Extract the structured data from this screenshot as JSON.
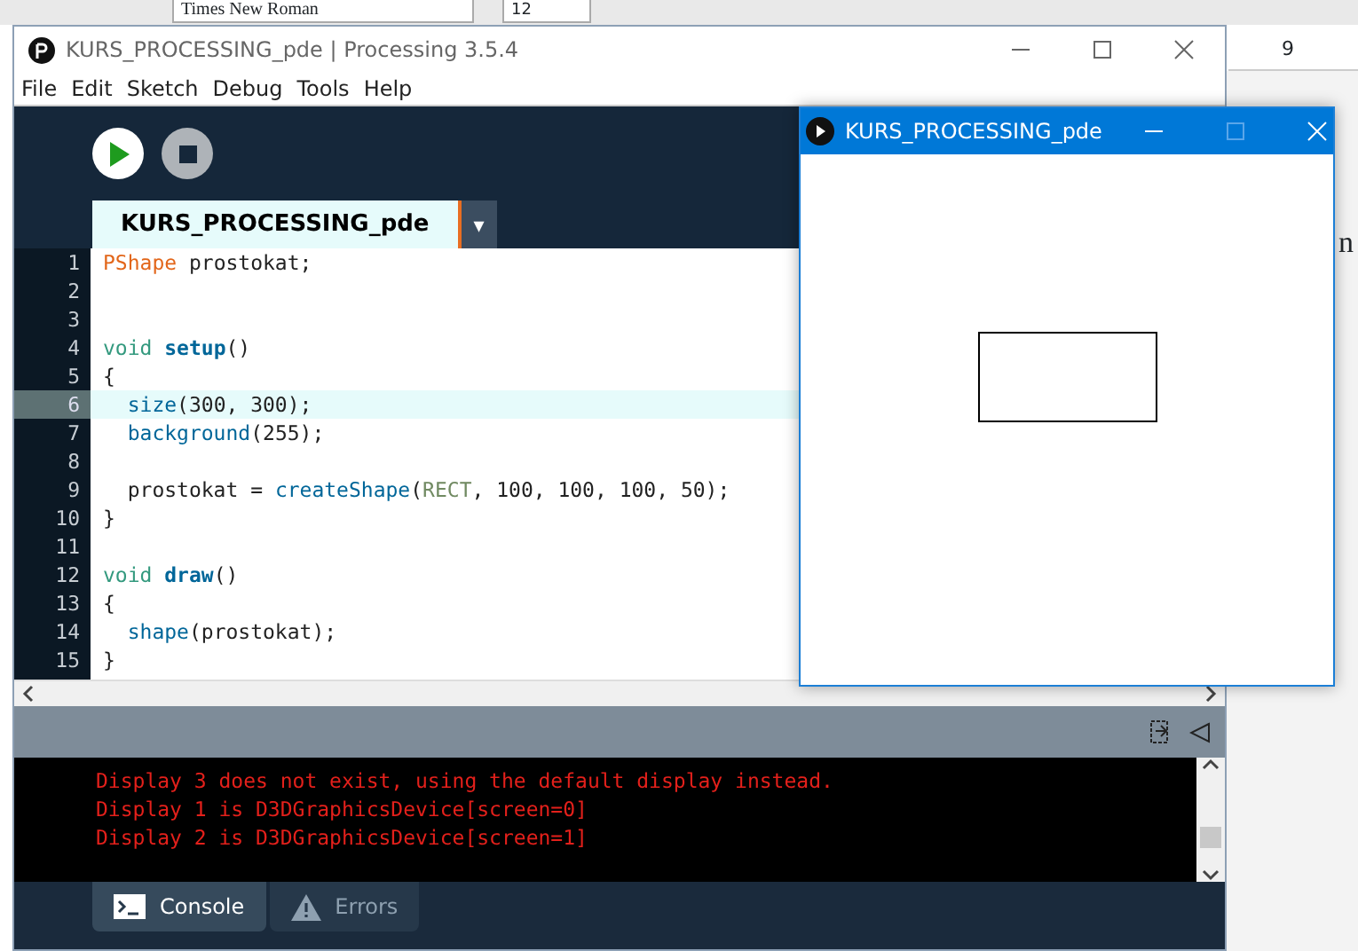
{
  "background_app": {
    "font_field": "Times New Roman",
    "size_field": "12",
    "ruler_number": "9",
    "page_text": "n"
  },
  "window": {
    "title": "KURS_PROCESSING_pde | Processing 3.5.4"
  },
  "menu": [
    "File",
    "Edit",
    "Sketch",
    "Debug",
    "Tools",
    "Help"
  ],
  "tabs": [
    {
      "label": "KURS_PROCESSING_pde",
      "selected": true
    }
  ],
  "tab_menu": "▾",
  "editor": {
    "lines": [
      {
        "number": "1",
        "highlighted": false,
        "tokens": [
          {
            "text": "PShape",
            "kind": "type"
          },
          {
            "text": " prostokat;",
            "kind": "plain"
          }
        ]
      },
      {
        "number": "2",
        "highlighted": false
      },
      {
        "number": "3",
        "highlighted": false
      },
      {
        "number": "4",
        "highlighted": false,
        "tokens": [
          {
            "text": "void ",
            "kind": "keyword"
          },
          {
            "text": "setup",
            "kind": "definition"
          },
          {
            "text": "()",
            "kind": "plain"
          }
        ]
      },
      {
        "number": "5",
        "highlighted": false,
        "tokens": [
          {
            "text": "{",
            "kind": "plain"
          }
        ]
      },
      {
        "number": "6",
        "highlighted": true,
        "indented": true,
        "tokens": [
          {
            "text": "size",
            "kind": "function"
          },
          {
            "text": "(300, 300);",
            "kind": "plain"
          }
        ]
      },
      {
        "number": "7",
        "highlighted": false,
        "indented": true,
        "tokens": [
          {
            "text": "background",
            "kind": "function"
          },
          {
            "text": "(255);",
            "kind": "plain"
          }
        ]
      },
      {
        "number": "8",
        "highlighted": false
      },
      {
        "number": "9",
        "highlighted": false,
        "indented": true,
        "tokens": [
          {
            "text": "prostokat = ",
            "kind": "plain"
          },
          {
            "text": "createShape",
            "kind": "function"
          },
          {
            "text": "(",
            "kind": "plain"
          },
          {
            "text": "RECT",
            "kind": "constant"
          },
          {
            "text": ", 100, 100, 100, 50);",
            "kind": "plain"
          }
        ]
      },
      {
        "number": "10",
        "highlighted": false,
        "tokens": [
          {
            "text": "}",
            "kind": "plain"
          }
        ]
      },
      {
        "number": "11",
        "highlighted": false
      },
      {
        "number": "12",
        "highlighted": false,
        "tokens": [
          {
            "text": "void ",
            "kind": "keyword"
          },
          {
            "text": "draw",
            "kind": "definition"
          },
          {
            "text": "()",
            "kind": "plain"
          }
        ]
      },
      {
        "number": "13",
        "highlighted": false,
        "tokens": [
          {
            "text": "{",
            "kind": "plain"
          }
        ]
      },
      {
        "number": "14",
        "highlighted": false,
        "indented": true,
        "tokens": [
          {
            "text": "shape",
            "kind": "function"
          },
          {
            "text": "(prostokat);",
            "kind": "plain"
          }
        ]
      },
      {
        "number": "15",
        "highlighted": false,
        "tokens": [
          {
            "text": "}",
            "kind": "plain"
          }
        ]
      }
    ]
  },
  "console": {
    "lines": [
      "Display 3 does not exist, using the default display instead.",
      "Display 1 is D3DGraphicsDevice[screen=0]",
      "Display 2 is D3DGraphicsDevice[screen=1]"
    ]
  },
  "console_tabs": [
    {
      "label": "Console",
      "kind": "console",
      "selected": true
    },
    {
      "label": "Errors",
      "kind": "errors",
      "selected": false
    }
  ],
  "sketch_window": {
    "title": "KURS_PROCESSING_pde"
  }
}
